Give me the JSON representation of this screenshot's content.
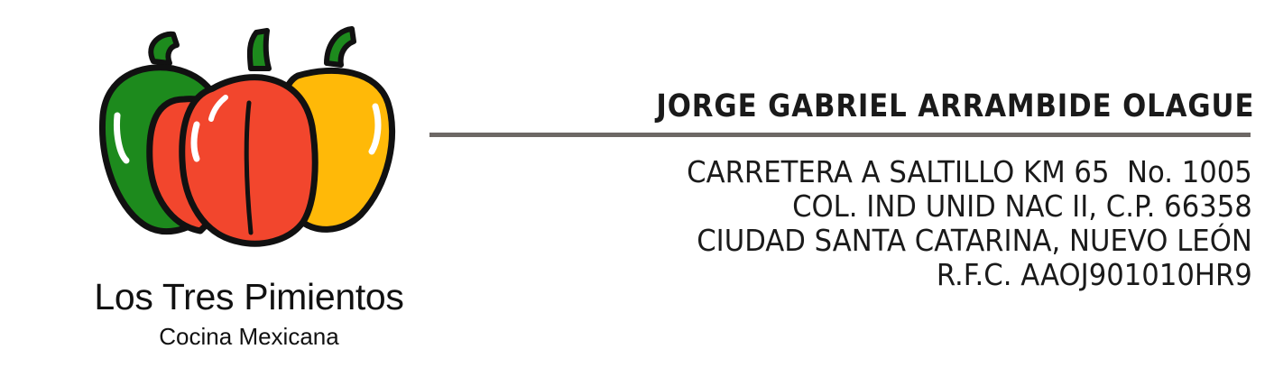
{
  "logo": {
    "icon": "three-bell-peppers-icon",
    "name": "Los Tres Pimientos",
    "tagline": "Cocina Mexicana",
    "colors": {
      "green": "#1d8a1d",
      "red": "#f2462d",
      "yellow": "#ffb908",
      "outline": "#111111"
    }
  },
  "contact": {
    "name": "JORGE GABRIEL ARRAMBIDE OLAGUE",
    "address_lines": [
      "CARRETERA A SALTILLO KM 65  No. 1005",
      "COL. IND UNID NAC II, C.P. 66358",
      "CIUDAD SANTA CATARINA, NUEVO LEÓN",
      "R.F.C. AAOJ901010HR9"
    ]
  },
  "divider_color": "#6d6865"
}
